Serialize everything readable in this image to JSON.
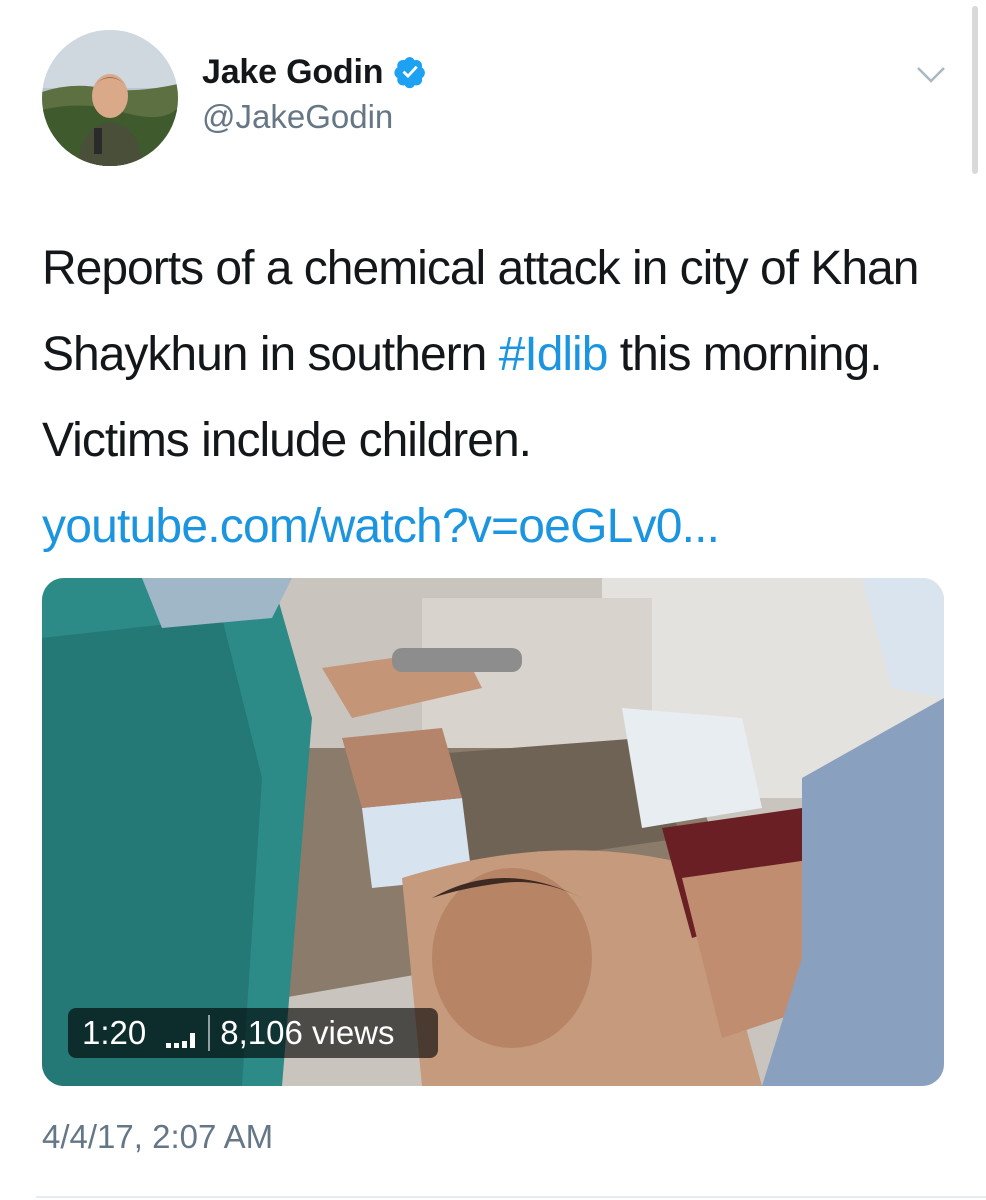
{
  "author": {
    "display_name": "Jake Godin",
    "handle": "@JakeGodin",
    "verified": true
  },
  "tweet": {
    "text_part1": "Reports of a chemical attack in city of Khan Shaykhun in southern ",
    "hashtag": "#Idlib",
    "text_part2": " this morning. Victims include children.",
    "link": "youtube.com/watch?v=oeGLv0..."
  },
  "media": {
    "type": "video",
    "duration": "1:20",
    "views": "8,106 views"
  },
  "timestamp": "4/4/17, 2:07 AM",
  "icons": {
    "verified": "verified-badge-icon",
    "menu": "chevron-down-icon",
    "live": "signal-bars-icon"
  },
  "colors": {
    "link": "#1b95e0",
    "secondary_text": "#657786",
    "primary_text": "#14171a"
  }
}
